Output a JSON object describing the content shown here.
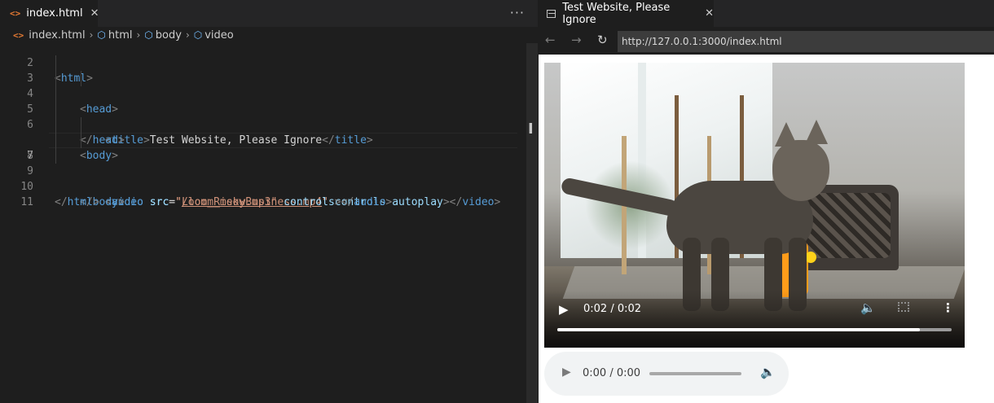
{
  "editor": {
    "tab_label": "index.html",
    "tab_close": "✕",
    "more_actions": "···",
    "breadcrumb": [
      "index.html",
      "html",
      "body",
      "video"
    ],
    "line_numbers": [
      "2",
      "3",
      "4",
      "5",
      "6",
      "7",
      "8",
      "9",
      "10",
      "11"
    ],
    "current_line": "7",
    "code": {
      "l2_tag": "html",
      "l3_tag": "head",
      "l4_tag": "title",
      "l4_text": "Test Website, Please Ignore",
      "l4_close": "title",
      "l5_close": "head",
      "l6_tag": "body",
      "l7_tag": "video",
      "l7_attr_src": "src",
      "l7_src_value": "Loom_RiskyBusiness.mp4",
      "l7_controls": "controls",
      "l7_autoplay": "autoplay",
      "l7_close": "video",
      "l8_tag": "audio",
      "l8_attr_src": "src",
      "l8_src_value": "/loom_meow.mp3",
      "l8_controls": "controls",
      "l8_close": "audio",
      "l9_close": "body",
      "l10_close": "html"
    }
  },
  "browser": {
    "tab_title": "Test Website, Please Ignore",
    "tab_close": "✕",
    "url": "http://127.0.0.1:3000/index.html",
    "video": {
      "time": "0:02 / 0:02",
      "progress": 0.92
    },
    "audio": {
      "time": "0:00 / 0:00"
    }
  }
}
